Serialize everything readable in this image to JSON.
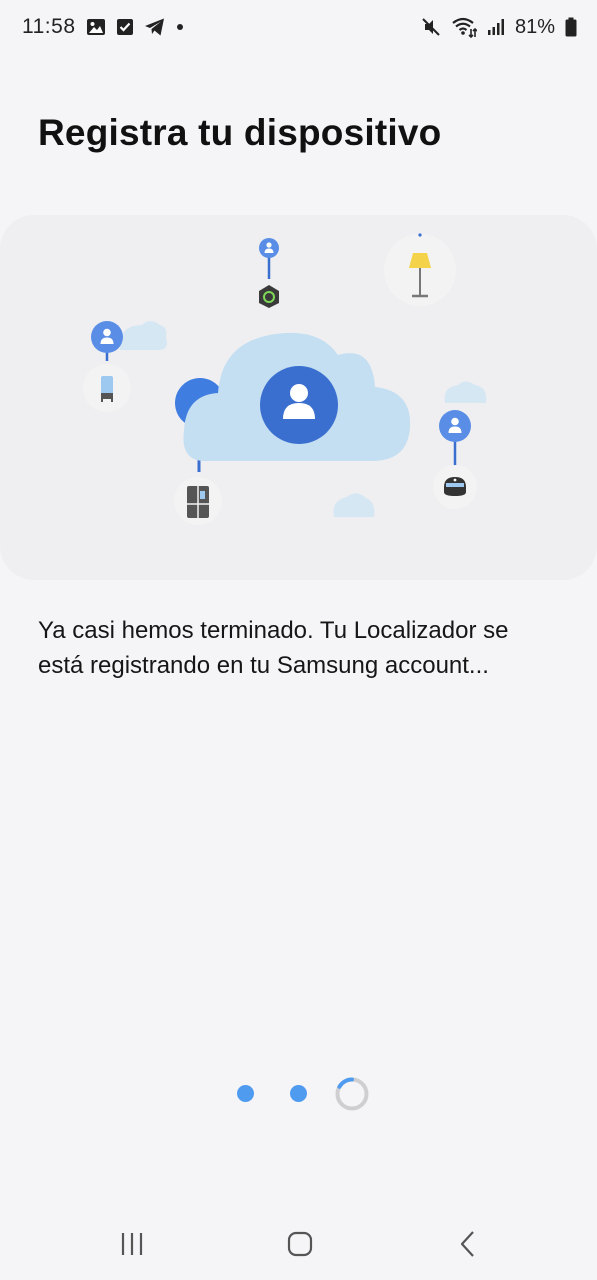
{
  "status_bar": {
    "time": "11:58",
    "battery": "81%",
    "left_icons": [
      "gallery-icon",
      "checkbox-icon",
      "telegram-icon",
      "dot-icon"
    ],
    "right_icons": [
      "mute-icon",
      "wifi-icon",
      "signal-icon",
      "battery-icon"
    ]
  },
  "page": {
    "title": "Registra tu dispositivo",
    "description_line1": "Ya casi hemos terminado. Tu Localizador se",
    "description_line2": "está registrando en tu Samsung account..."
  },
  "illustration": {
    "icons": [
      "cloud-icon",
      "user-icon",
      "smarttag-icon",
      "floor-lamp-icon",
      "air-purifier-icon",
      "refrigerator-icon",
      "robot-vacuum-icon"
    ]
  },
  "progress": {
    "steps_completed": 2,
    "current_step_state": "loading",
    "accent": "#4f9bf0"
  },
  "nav_bar": {
    "buttons": [
      "recent-apps-icon",
      "home-icon",
      "back-icon"
    ]
  }
}
